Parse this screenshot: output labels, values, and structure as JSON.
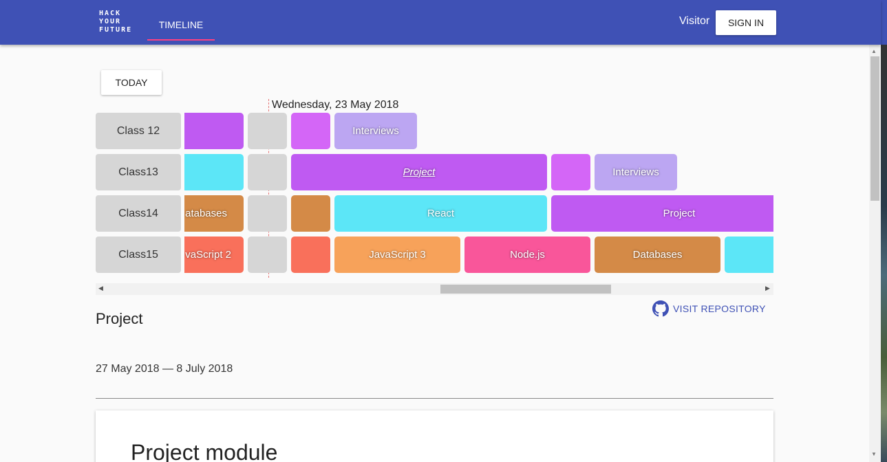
{
  "header": {
    "logo_lines": [
      "HACK",
      "YOUR",
      "FUTURE"
    ],
    "tab_timeline": "TIMELINE",
    "visitor": "Visitor",
    "sign_in": "SIGN IN"
  },
  "toolbar": {
    "today": "TODAY"
  },
  "timeline": {
    "current_date": "Wednesday, 23 May 2018",
    "rows": [
      {
        "label": "Class 12",
        "cells": [
          {
            "text": "",
            "color": "#bf5af2"
          },
          {
            "text": "",
            "color": "#d6d6d6"
          },
          {
            "text": "",
            "color": "#d466f7"
          },
          {
            "text": "Interviews",
            "color": "#bca6f2"
          }
        ]
      },
      {
        "label": "Class13",
        "cells": [
          {
            "text": "",
            "color": "#5ce6f7"
          },
          {
            "text": "",
            "color": "#d6d6d6"
          },
          {
            "text": "Project",
            "color": "#bf5af2",
            "italic": true
          },
          {
            "text": "",
            "color": "#d466f7"
          },
          {
            "text": "Interviews",
            "color": "#bca6f2"
          }
        ]
      },
      {
        "label": "Class14",
        "cells": [
          {
            "text": "atabases",
            "color": "#d48a47"
          },
          {
            "text": "",
            "color": "#d6d6d6"
          },
          {
            "text": "",
            "color": "#d48a47"
          },
          {
            "text": "React",
            "color": "#5ce6f7"
          },
          {
            "text": "Project",
            "color": "#bf5af2"
          }
        ]
      },
      {
        "label": "Class15",
        "cells": [
          {
            "text": "vaScript 2",
            "color": "#f9705b"
          },
          {
            "text": "",
            "color": "#d6d6d6"
          },
          {
            "text": "",
            "color": "#f9705b"
          },
          {
            "text": "JavaScript 3",
            "color": "#f7a25a"
          },
          {
            "text": "Node.js",
            "color": "#f9569a"
          },
          {
            "text": "Databases",
            "color": "#d48a47"
          },
          {
            "text": "",
            "color": "#5ce6f7"
          }
        ]
      }
    ]
  },
  "detail": {
    "title": "Project",
    "visit_repository": "VISIT REPOSITORY",
    "date_range": "27 May 2018 — 8 July 2018",
    "card_title": "Project module"
  }
}
